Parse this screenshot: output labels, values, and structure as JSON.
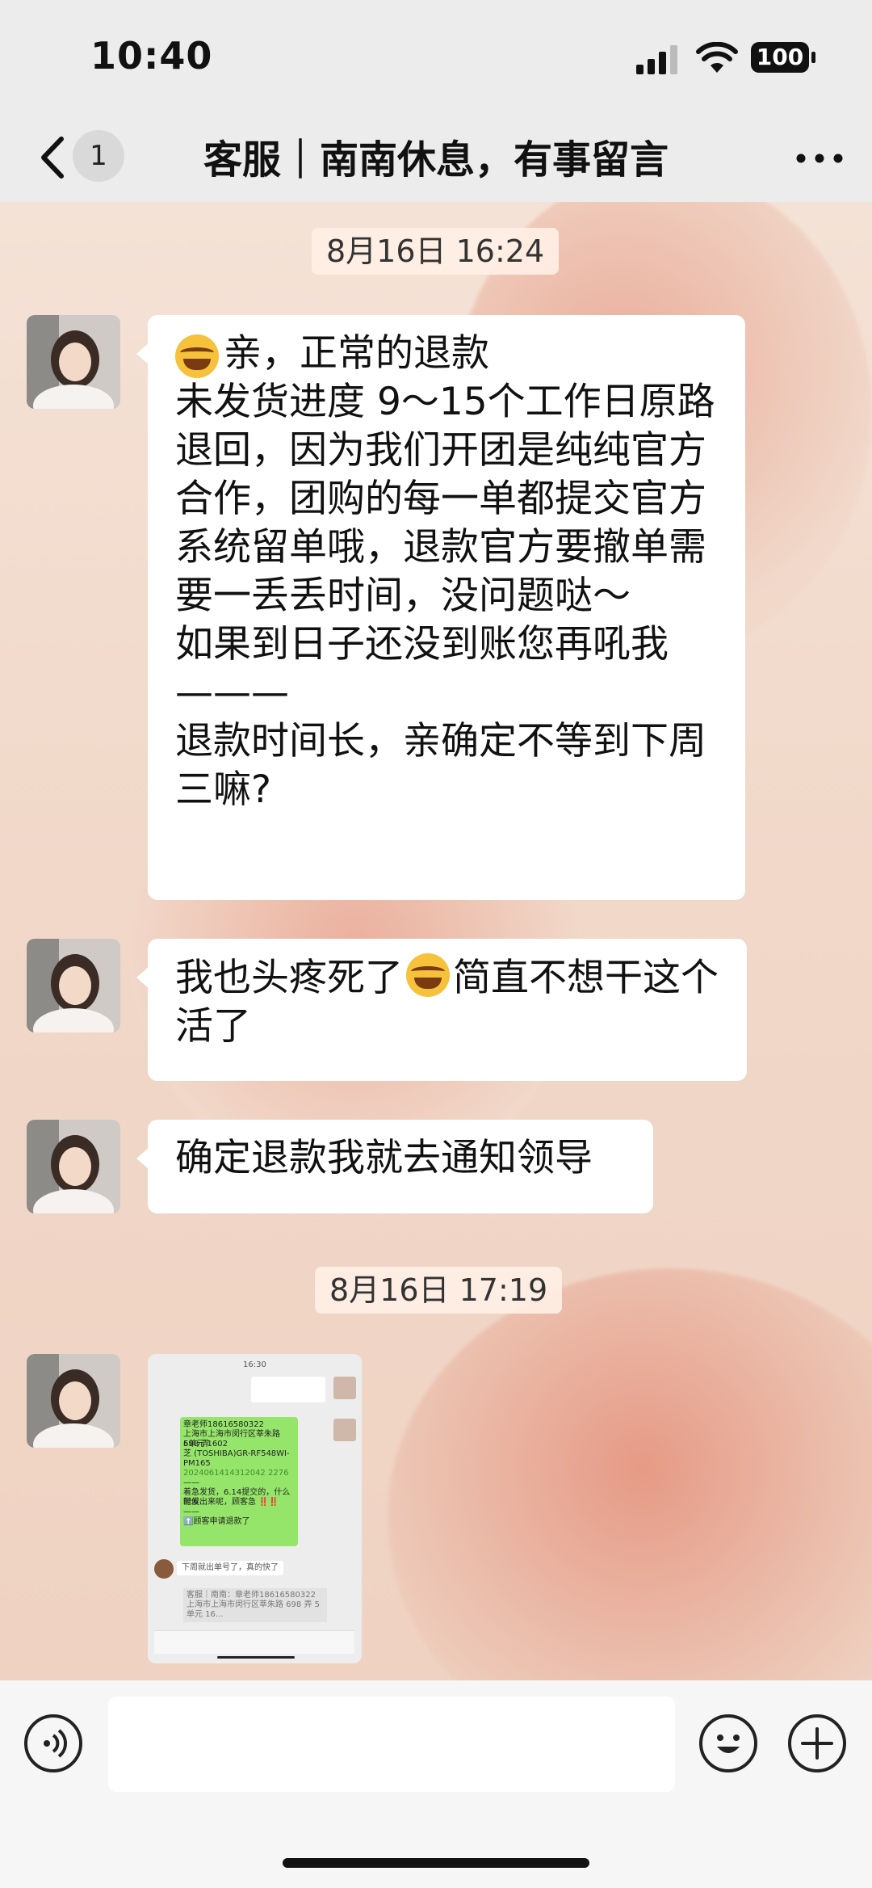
{
  "status_bar": {
    "time": "10:40",
    "battery": "100"
  },
  "nav": {
    "unread_count": "1",
    "title": "客服｜南南休息，有事留言"
  },
  "messages": {
    "ts1": "8月16日 16:24",
    "m1": "亲，正常的退款\n未发货进度 9～15个工作日原路退回，因为我们开团是纯纯官方合作，团购的每一单都提交官方系统留单哦，退款官方要撤单需要一丢丢时间，没问题哒～\n如果到日子还没到账您再吼我\n———\n退款时间长，亲确定不等到下周三嘛?",
    "m2a": "我也头疼死了",
    "m2b": "简直不想干这个活了",
    "m3": "确定退款我就去通知领导",
    "ts2": "8月16日 17:19"
  },
  "thumbnail": {
    "time": "16:30",
    "lines": [
      "章老师18616580322",
      "上海市上海市闵行区莘朱路 698 弄",
      "5单元 1602",
      "芝 (TOSHIBA)GR-RF548WI-",
      "PM165",
      "2024061414312042 2276",
      "——",
      "着急发货，6.14提交的，什么时候",
      "能发出来呢，顾客急 ‼️‼️",
      "——",
      "⬆️顾客申请退款了"
    ],
    "reply": "下周就出单号了，真的快了",
    "quote": "客服｜南南：章老师18616580322 上海市上海市闵行区莘朱路 698 弄 5 单元 16..."
  },
  "colors": {
    "navbar_bg": "#ececec",
    "bubble_bg": "#ffffff",
    "wechat_green": "#95e56a"
  },
  "icons": [
    "back-chevron-icon",
    "more-icon",
    "voice-icon",
    "emoji-icon",
    "plus-icon",
    "signal-icon",
    "wifi-icon",
    "battery-icon"
  ]
}
